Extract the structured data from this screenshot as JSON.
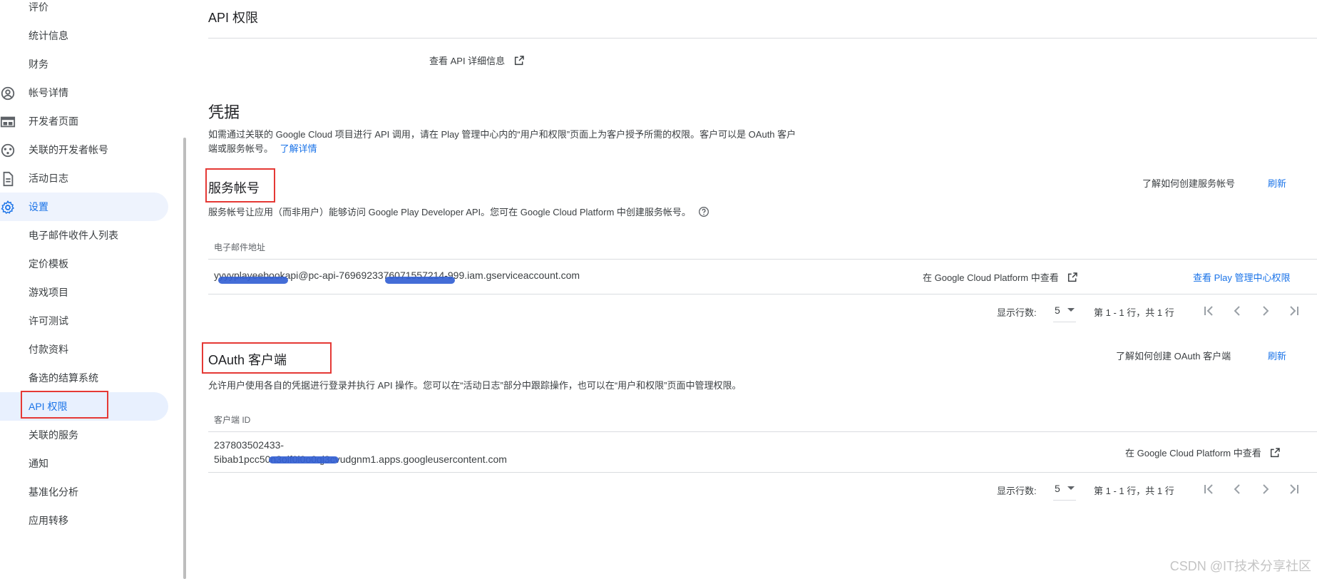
{
  "sidebar": {
    "items": [
      {
        "label": "评价",
        "icon": null
      },
      {
        "label": "统计信息",
        "icon": null
      },
      {
        "label": "财务",
        "icon": null
      },
      {
        "label": "帐号详情",
        "icon": "account-circle-icon"
      },
      {
        "label": "开发者页面",
        "icon": "web-page-icon"
      },
      {
        "label": "关联的开发者帐号",
        "icon": "linked-accounts-icon"
      },
      {
        "label": "活动日志",
        "icon": "document-icon"
      },
      {
        "label": "设置",
        "icon": "gear-icon"
      },
      {
        "label": "电子邮件收件人列表",
        "icon": null
      },
      {
        "label": "定价模板",
        "icon": null
      },
      {
        "label": "游戏项目",
        "icon": null
      },
      {
        "label": "许可测试",
        "icon": null
      },
      {
        "label": "付款资料",
        "icon": null
      },
      {
        "label": "备选的结算系统",
        "icon": null
      },
      {
        "label": "API 权限",
        "icon": null
      },
      {
        "label": "关联的服务",
        "icon": null
      },
      {
        "label": "通知",
        "icon": null
      },
      {
        "label": "基准化分析",
        "icon": null
      },
      {
        "label": "应用转移",
        "icon": null
      }
    ]
  },
  "page": {
    "title": "API 权限",
    "view_api_details": "查看 API 详细信息"
  },
  "credentials": {
    "heading": "凭据",
    "desc_line1": "如需通过关联的 Google Cloud 项目进行 API 调用，请在 Play 管理中心内的“用户和权限”页面上为客户授予所需的权限。客户可以是 OAuth 客户",
    "desc_line2": "端或服务帐号。",
    "learn_more": "了解详情"
  },
  "service_accounts": {
    "heading": "服务帐号",
    "learn_link": "了解如何创建服务帐号",
    "refresh": "刷新",
    "desc": "服务帐号让应用（而非用户）能够访问 Google Play Developer API。您可在 Google Cloud Platform 中创建服务帐号。",
    "col_email": "电子邮件地址",
    "row_email": "yyyyplayeebookapi@pc-api-7696923376071557214-999.iam.gserviceaccount.com",
    "row_view_gcp": "在 Google Cloud Platform 中查看",
    "row_view_play": "查看 Play 管理中心权限",
    "rows_label": "显示行数:",
    "rows_value": "5",
    "range": "第 1 - 1 行，共 1 行"
  },
  "oauth_clients": {
    "heading": "OAuth 客户端",
    "learn_link": "了解如何创建 OAuth 客户端",
    "refresh": "刷新",
    "desc": "允许用户使用各自的凭据进行登录并执行 API 操作。您可以在“活动日志”部分中跟踪操作，也可以在“用户和权限”页面中管理权限。",
    "col_client_id": "客户端 ID",
    "row_id_line1": "237803502433-",
    "row_id_line2": "5ibab1pcc50n3oif0i0o0qj3cvudgnm1.apps.googleusercontent.com",
    "row_view_gcp": "在 Google Cloud Platform 中查看",
    "rows_label": "显示行数:",
    "rows_value": "5",
    "range": "第 1 - 1 行，共 1 行"
  },
  "watermark": "CSDN @IT技术分享社区",
  "colors": {
    "accent": "#1a73e8",
    "annotation": "#e53935",
    "redaction": "#3461d4"
  }
}
